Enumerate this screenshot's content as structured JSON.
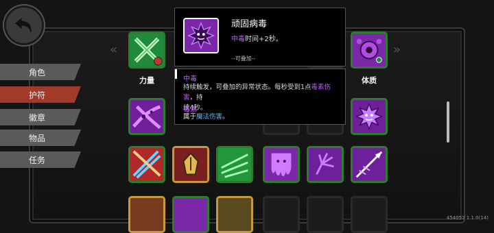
{
  "sidebar": {
    "items": [
      {
        "label": "角色"
      },
      {
        "label": "护符"
      },
      {
        "label": "徽章"
      },
      {
        "label": "物品"
      },
      {
        "label": "任务"
      }
    ]
  },
  "labels": {
    "strength": "力量",
    "constitution": "体质"
  },
  "tooltip_top": {
    "title": "顽固病毒",
    "effect_keyword": "中毒",
    "effect_text": "时间+2秒。",
    "stack_note": "--可叠加--"
  },
  "tooltip_info": {
    "poison_title": "中毒",
    "poison_text_1": "持续触发，可叠加的异常状态。每秒受到1点",
    "poison_keyword": "毒素伤害",
    "poison_text_2": "，持",
    "poison_text_3": "续4秒。",
    "toxin_title": "毒素",
    "toxin_text_1": "属于",
    "toxin_keyword": "魔法伤害",
    "toxin_text_2": "。"
  },
  "version": "454052 1.1.0(14)",
  "colors": {
    "green_border": "#2e7d2e",
    "gold_border": "#c69a3c",
    "active_tab": "#a23a2a",
    "keyword_purple": "#c25bff",
    "keyword_blue": "#5fb8ff"
  }
}
